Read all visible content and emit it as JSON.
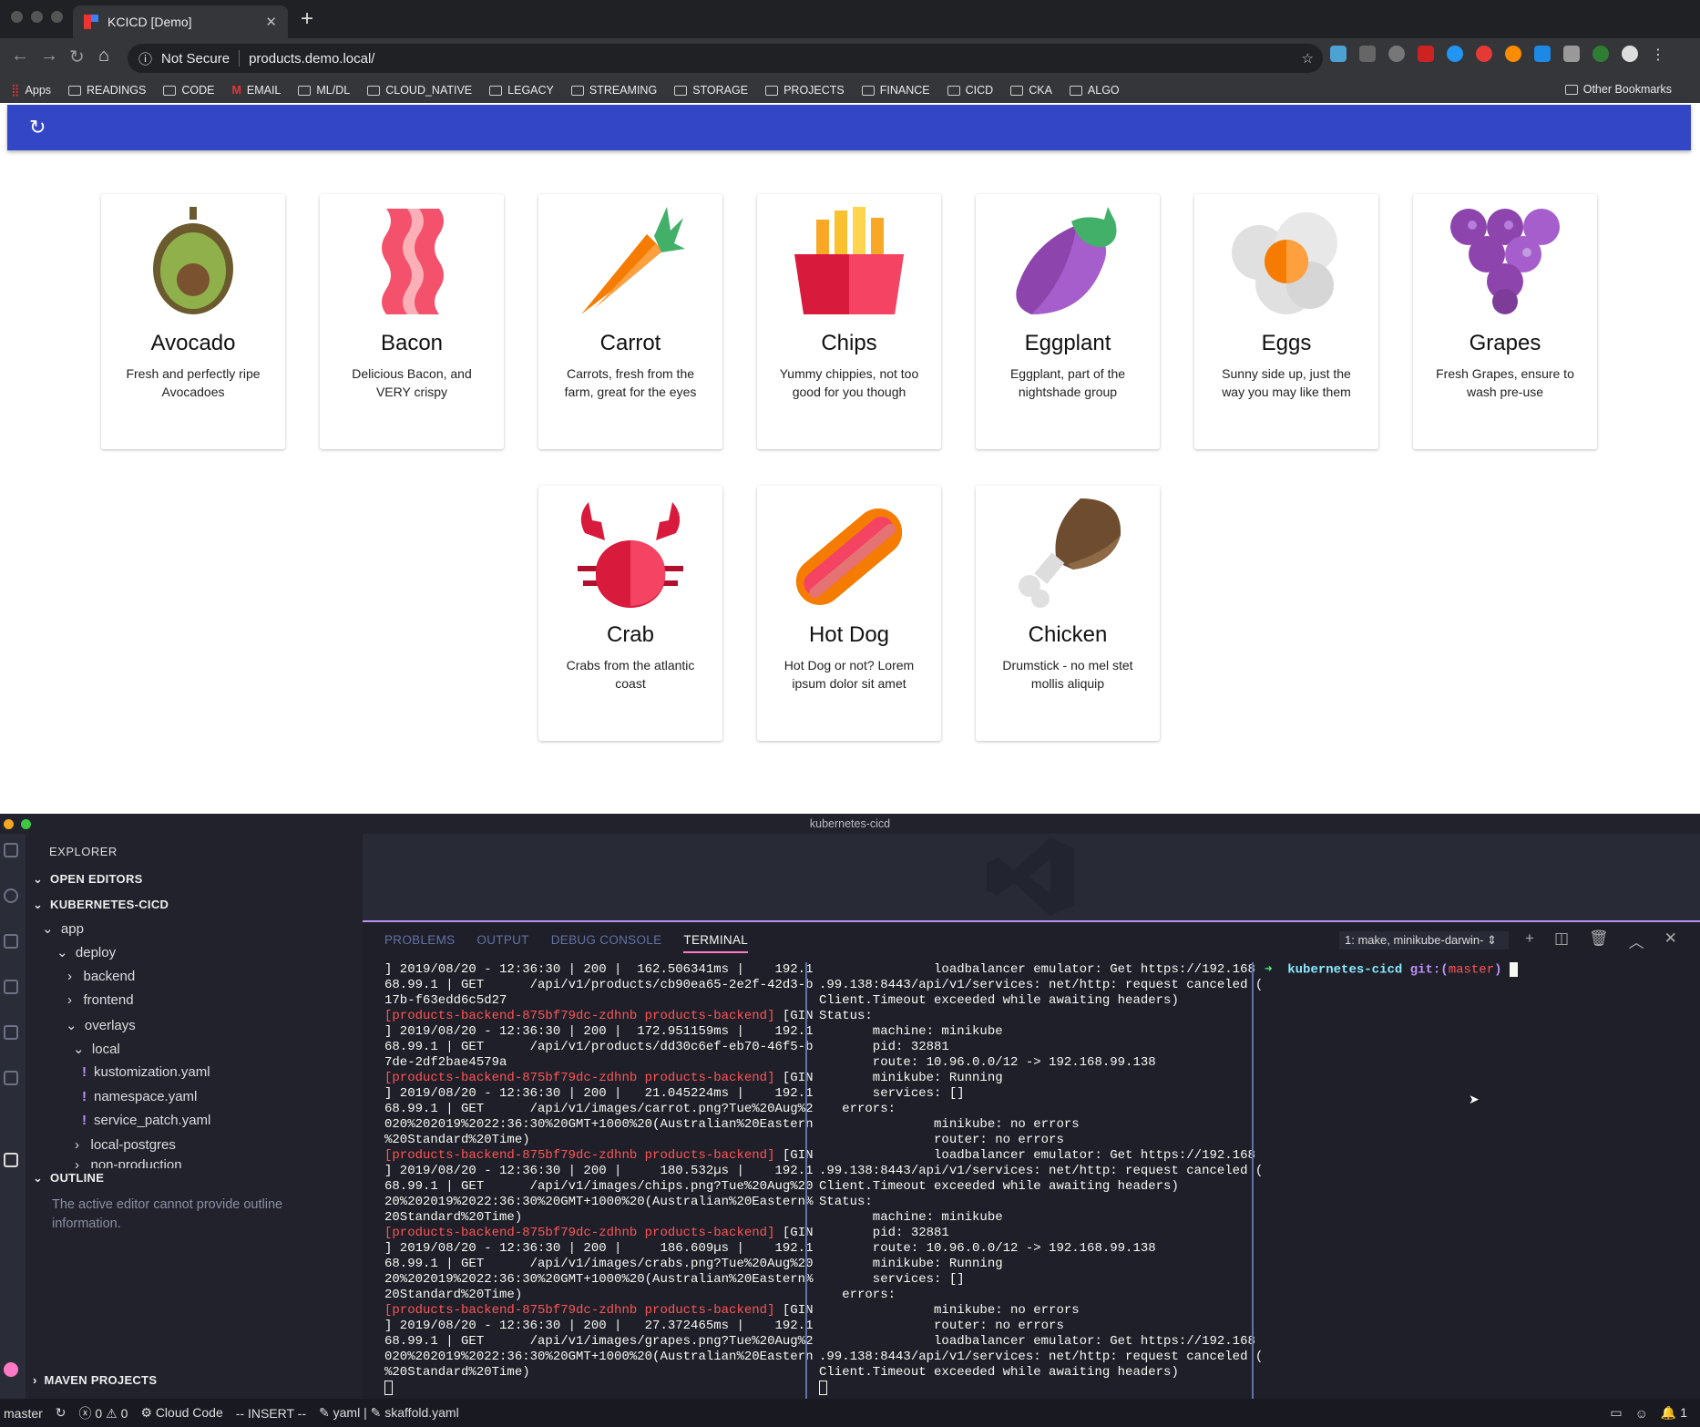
{
  "browser": {
    "tab_title": "KCICD [Demo]",
    "security": "Not Secure",
    "url": "products.demo.local/",
    "bookmarks": [
      "Apps",
      "READINGS",
      "CODE",
      "EMAIL",
      "ML/DL",
      "CLOUD_NATIVE",
      "LEGACY",
      "STREAMING",
      "STORAGE",
      "PROJECTS",
      "FINANCE",
      "CICD",
      "CKA",
      "ALGO"
    ],
    "other_bookmarks": "Other Bookmarks"
  },
  "app": {
    "products": [
      {
        "title": "Avocado",
        "desc": "Fresh and perfectly ripe Avocadoes"
      },
      {
        "title": "Bacon",
        "desc": "Delicious Bacon, and VERY crispy"
      },
      {
        "title": "Carrot",
        "desc": "Carrots, fresh from the farm, great for the eyes"
      },
      {
        "title": "Chips",
        "desc": "Yummy chippies, not too good for you though"
      },
      {
        "title": "Eggplant",
        "desc": "Eggplant, part of the nightshade group"
      },
      {
        "title": "Eggs",
        "desc": "Sunny side up, just the way you may like them"
      },
      {
        "title": "Grapes",
        "desc": "Fresh Grapes, ensure to wash pre-use"
      },
      {
        "title": "Crab",
        "desc": "Crabs from the atlantic coast"
      },
      {
        "title": "Hot Dog",
        "desc": "Hot Dog or not? Lorem ipsum dolor sit amet"
      },
      {
        "title": "Chicken",
        "desc": "Drumstick - no mel stet mollis aliquip"
      }
    ]
  },
  "vscode": {
    "window_title": "kubernetes-cicd",
    "explorer": "EXPLORER",
    "open_editors": "OPEN EDITORS",
    "project": "KUBERNETES-CICD",
    "tree": [
      "app",
      "deploy",
      "backend",
      "frontend",
      "overlays",
      "local",
      "kustomization.yaml",
      "namespace.yaml",
      "service_patch.yaml",
      "local-postgres",
      "non-production"
    ],
    "outline": "OUTLINE",
    "outline_msg": "The active editor cannot provide outline information.",
    "maven": "MAVEN PROJECTS",
    "panel_tabs": [
      "PROBLEMS",
      "OUTPUT",
      "DEBUG CONSOLE",
      "TERMINAL"
    ],
    "terminal_select": "1: make, minikube-darwin-",
    "term1": [
      "] 2019/08/20 - 12:36:30 | 200 |  162.506341ms |    192.1",
      "68.99.1 | GET      /api/v1/products/cb90ea65-2e2f-42d3-b",
      "17b-f63edd6c5d27",
      "[products-backend-875bf79dc-zdhnb products-backend] [GIN",
      "] 2019/08/20 - 12:36:30 | 200 |  172.951159ms |    192.1",
      "68.99.1 | GET      /api/v1/products/dd30c6ef-eb70-46f5-b",
      "7de-2df2bae4579a",
      "[products-backend-875bf79dc-zdhnb products-backend] [GIN",
      "] 2019/08/20 - 12:36:30 | 200 |   21.045224ms |    192.1",
      "68.99.1 | GET      /api/v1/images/carrot.png?Tue%20Aug%2",
      "020%202019%2022:36:30%20GMT+1000%20(Australian%20Eastern",
      "%20Standard%20Time)",
      "[products-backend-875bf79dc-zdhnb products-backend] [GIN",
      "] 2019/08/20 - 12:36:30 | 200 |     180.532µs |    192.1",
      "68.99.1 | GET      /api/v1/images/chips.png?Tue%20Aug%20",
      "20%202019%2022:36:30%20GMT+1000%20(Australian%20Eastern%",
      "20Standard%20Time)",
      "[products-backend-875bf79dc-zdhnb products-backend] [GIN",
      "] 2019/08/20 - 12:36:30 | 200 |     186.609µs |    192.1",
      "68.99.1 | GET      /api/v1/images/crabs.png?Tue%20Aug%20",
      "20%202019%2022:36:30%20GMT+1000%20(Australian%20Eastern%",
      "20Standard%20Time)",
      "[products-backend-875bf79dc-zdhnb products-backend] [GIN",
      "] 2019/08/20 - 12:36:30 | 200 |   27.372465ms |    192.1",
      "68.99.1 | GET      /api/v1/images/grapes.png?Tue%20Aug%2",
      "020%202019%2022:36:30%20GMT+1000%20(Australian%20Eastern",
      "%20Standard%20Time)"
    ],
    "term2": [
      "               loadbalancer emulator: Get https://192.168",
      ".99.138:8443/api/v1/services: net/http: request canceled (",
      "Client.Timeout exceeded while awaiting headers)",
      "Status:",
      "       machine: minikube",
      "       pid: 32881",
      "       route: 10.96.0.0/12 -> 192.168.99.138",
      "       minikube: Running",
      "       services: []",
      "   errors:",
      "               minikube: no errors",
      "               router: no errors",
      "               loadbalancer emulator: Get https://192.168",
      ".99.138:8443/api/v1/services: net/http: request canceled (",
      "Client.Timeout exceeded while awaiting headers)",
      "Status:",
      "       machine: minikube",
      "       pid: 32881",
      "       route: 10.96.0.0/12 -> 192.168.99.138",
      "       minikube: Running",
      "       services: []",
      "   errors:",
      "               minikube: no errors",
      "               router: no errors",
      "               loadbalancer emulator: Get https://192.168",
      ".99.138:8443/api/v1/services: net/http: request canceled (",
      "Client.Timeout exceeded while awaiting headers)"
    ],
    "prompt_dir": "kubernetes-cicd",
    "prompt_git": "git:(",
    "prompt_branch": "master",
    "prompt_close": ")",
    "status": {
      "branch": "master",
      "errors": "0",
      "warnings": "0",
      "cloud": "Cloud Code",
      "mode": "-- INSERT --",
      "file1": "yaml",
      "file2": "skaffold.yaml",
      "notif": "1"
    }
  }
}
